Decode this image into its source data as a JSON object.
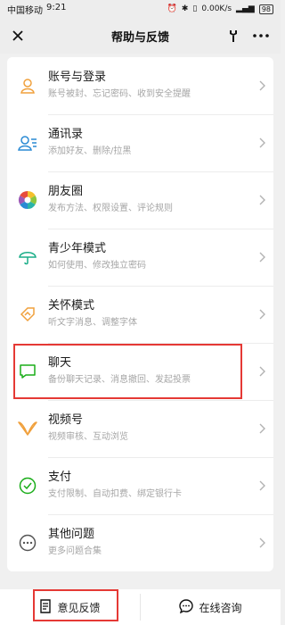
{
  "status_bar": {
    "carrier": "中国移动",
    "time": "9:21",
    "speed": "0.00K/s",
    "battery": "98"
  },
  "nav": {
    "title": "帮助与反馈"
  },
  "items": [
    {
      "title": "账号与登录",
      "subtitle": "账号被封、忘记密码、收到安全提醒",
      "icon": "person-icon"
    },
    {
      "title": "通讯录",
      "subtitle": "添加好友、删除/拉黑",
      "icon": "contacts-icon"
    },
    {
      "title": "朋友圈",
      "subtitle": "发布方法、权限设置、评论规则",
      "icon": "moments-icon"
    },
    {
      "title": "青少年模式",
      "subtitle": "如何使用、修改独立密码",
      "icon": "umbrella-icon"
    },
    {
      "title": "关怀模式",
      "subtitle": "听文字消息、调整字体",
      "icon": "care-icon"
    },
    {
      "title": "聊天",
      "subtitle": "备份聊天记录、消息撤回、发起投票",
      "icon": "chat-icon"
    },
    {
      "title": "视频号",
      "subtitle": "视频审核、互动浏览",
      "icon": "channels-icon"
    },
    {
      "title": "支付",
      "subtitle": "支付限制、自动扣费、绑定银行卡",
      "icon": "pay-icon"
    },
    {
      "title": "其他问题",
      "subtitle": "更多问题合集",
      "icon": "more-icon"
    }
  ],
  "bottom": {
    "feedback_label": "意见反馈",
    "consult_label": "在线咨询"
  },
  "colors": {
    "highlight": "#e53935",
    "subtitle": "#a6a6a6"
  }
}
